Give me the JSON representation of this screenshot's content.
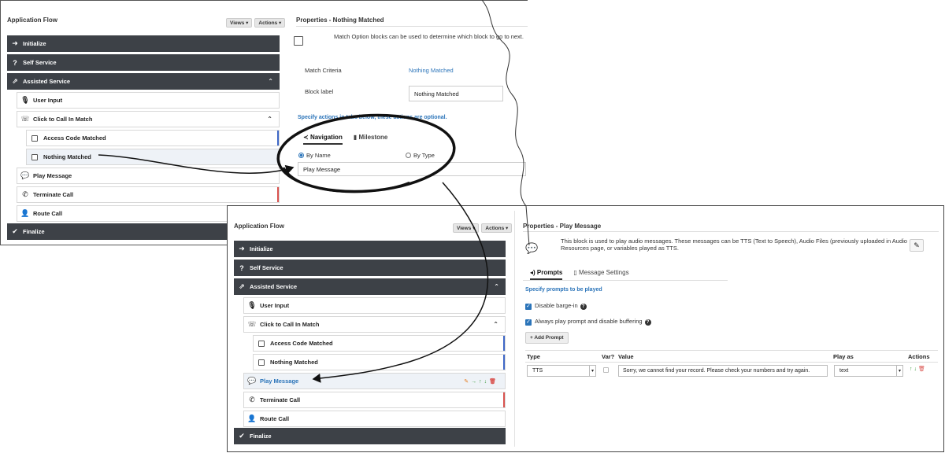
{
  "top": {
    "flow": {
      "title": "Application Flow",
      "views": "Views ▾",
      "actions": "Actions ▾",
      "items": [
        {
          "label": "Initialize"
        },
        {
          "label": "Self Service"
        },
        {
          "label": "Assisted Service"
        },
        {
          "label": "User Input"
        },
        {
          "label": "Click to Call In Match"
        },
        {
          "label": "Access Code Matched"
        },
        {
          "label": "Nothing Matched"
        },
        {
          "label": "Play Message"
        },
        {
          "label": "Terminate Call"
        },
        {
          "label": "Route Call"
        },
        {
          "label": "Finalize"
        }
      ]
    },
    "props": {
      "title": "Properties - Nothing Matched",
      "description": "Match Option blocks can be used to determine which block to go to next.",
      "match_criteria_label": "Match Criteria",
      "match_criteria_value": "Nothing Matched",
      "block_label_label": "Block label",
      "block_label_value": "Nothing Matched",
      "hint": "Specify actions in tabs below, these actions are optional.",
      "tabs": [
        "Navigation",
        "Milestone"
      ],
      "radio_by_name": "By Name",
      "radio_by_type": "By Type",
      "target_value": "Play Message"
    }
  },
  "bottom": {
    "flow": {
      "title": "Application Flow",
      "views": "Views ▾",
      "actions": "Actions ▾",
      "items": [
        {
          "label": "Initialize"
        },
        {
          "label": "Self Service"
        },
        {
          "label": "Assisted Service"
        },
        {
          "label": "User Input"
        },
        {
          "label": "Click to Call In Match"
        },
        {
          "label": "Access Code Matched"
        },
        {
          "label": "Nothing Matched"
        },
        {
          "label": "Play Message"
        },
        {
          "label": "Terminate Call"
        },
        {
          "label": "Route Call"
        },
        {
          "label": "Finalize"
        }
      ]
    },
    "props": {
      "title": "Properties - Play Message",
      "description": "This block is used to play audio messages. These messages can be TTS (Text to Speech), Audio Files (previously uploaded in Audio Resources page, or variables played as TTS.",
      "tabs": [
        "Prompts",
        "Message Settings"
      ],
      "hint": "Specify prompts to be played",
      "disable_barge_in": "Disable barge-in",
      "always_play": "Always play prompt and disable buffering",
      "add_prompt": "+ Add Prompt",
      "columns": [
        "Type",
        "Var?",
        "Value",
        "Play as",
        "Actions"
      ],
      "row": {
        "type": "TTS",
        "value": "Sorry, we cannot find your record.  Please check your numbers and try again.",
        "play_as": "text"
      }
    }
  },
  "colors": {
    "dark_row": "#3d4147",
    "accent_blue": "#2b74b9",
    "blue_bar": "#3f68c7",
    "red_bar": "#d9534f"
  }
}
